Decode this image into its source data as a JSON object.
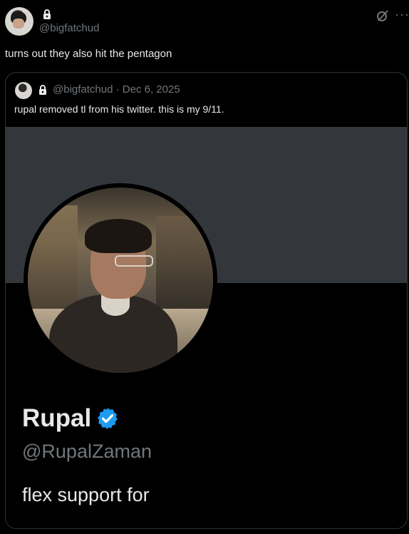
{
  "post": {
    "handle": "@bigfatchud",
    "text": "turns out they also hit the pentagon",
    "more_label": "···"
  },
  "quote": {
    "meta": "@bigfatchud · Dec 6, 2025",
    "text": "rupal removed tl from his twitter. this is my 9/11."
  },
  "profile_card": {
    "name": "Rupal",
    "handle": "@RupalZaman",
    "bio": "flex support for"
  },
  "colors": {
    "background": "#000000",
    "text": "#e7e9ea",
    "muted": "#71767b",
    "banner": "#33373c",
    "verified": "#1d9bf0"
  }
}
